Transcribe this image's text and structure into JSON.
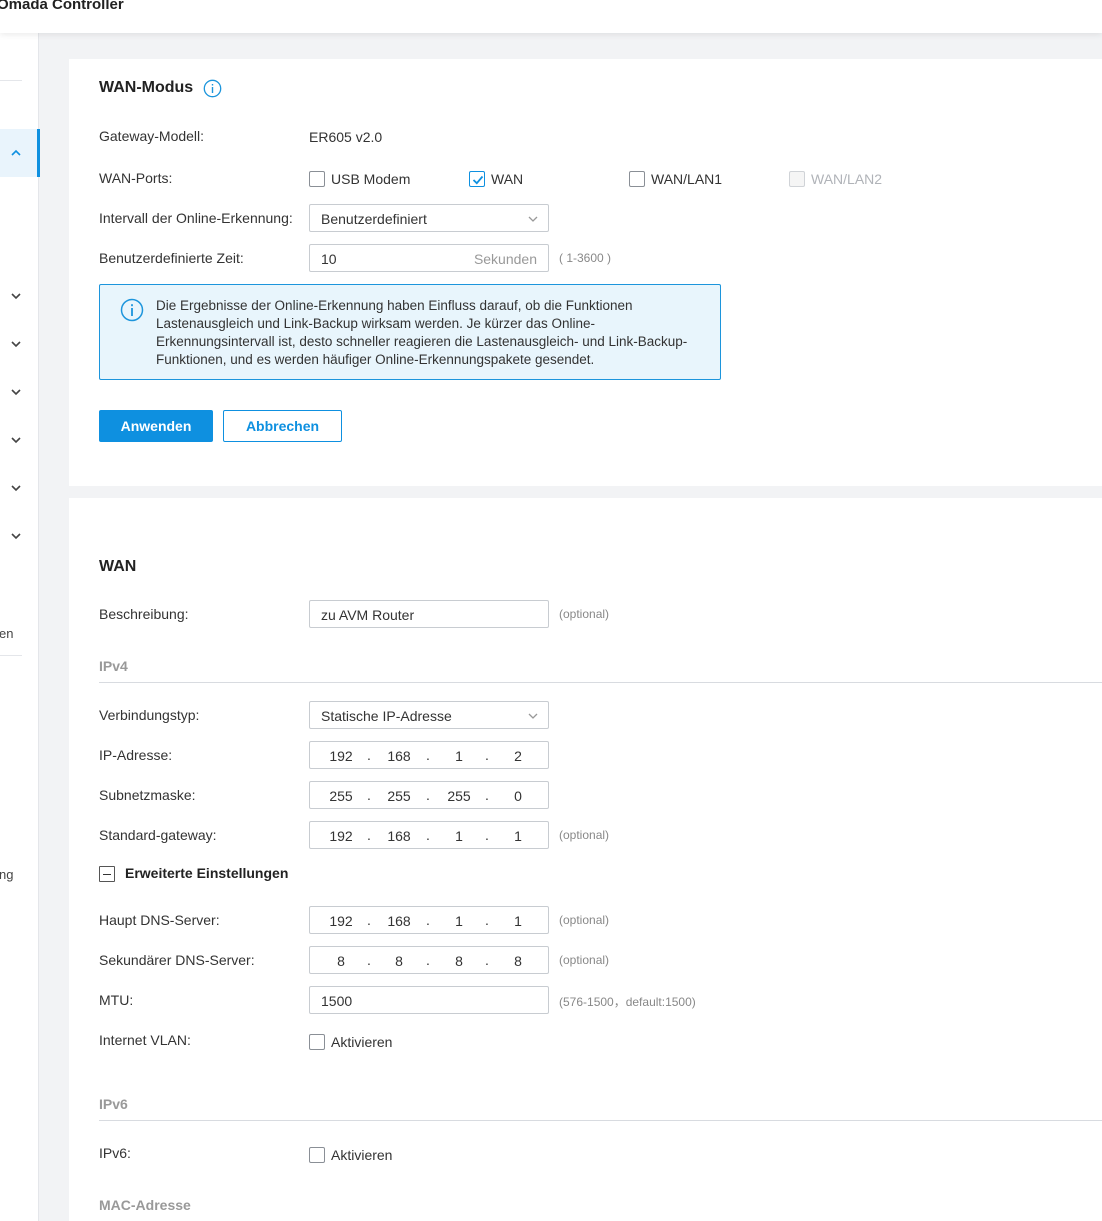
{
  "app": {
    "title": "Omada Controller"
  },
  "sidebar": {
    "fragments": [
      "en",
      "ng"
    ]
  },
  "wan_mode": {
    "title": "WAN-Modus",
    "gateway_model_label": "Gateway-Modell:",
    "gateway_model_value": "ER605 v2.0",
    "wan_ports_label": "WAN-Ports:",
    "ports": [
      {
        "label": "USB Modem",
        "checked": false,
        "disabled": false
      },
      {
        "label": "WAN",
        "checked": true,
        "disabled": false
      },
      {
        "label": "WAN/LAN1",
        "checked": false,
        "disabled": false
      },
      {
        "label": "WAN/LAN2",
        "checked": false,
        "disabled": true
      }
    ],
    "interval_label": "Intervall der Online-Erkennung:",
    "interval_value": "Benutzerdefiniert",
    "custom_time_label": "Benutzerdefinierte Zeit:",
    "custom_time_value": "10",
    "custom_time_unit": "Sekunden",
    "custom_time_range": "( 1-3600 )",
    "info_text": "Die Ergebnisse der Online-Erkennung haben Einfluss darauf, ob die Funktionen Lastenausgleich und Link-Backup wirksam werden. Je kürzer das Online-Erkennungsintervall ist, desto schneller reagieren die Lastenausgleich- und Link-Backup-Funktionen, und es werden häufiger Online-Erkennungspakete gesendet.",
    "apply_label": "Anwenden",
    "cancel_label": "Abbrechen"
  },
  "wan": {
    "title": "WAN",
    "description_label": "Beschreibung:",
    "description_value": "zu AVM Router",
    "optional": "(optional)",
    "ipv4_section": "IPv4",
    "connection_type_label": "Verbindungstyp:",
    "connection_type_value": "Statische IP-Adresse",
    "ip_label": "IP-Adresse:",
    "ip": [
      "192",
      "168",
      "1",
      "2"
    ],
    "subnet_label": "Subnetzmaske:",
    "subnet": [
      "255",
      "255",
      "255",
      "0"
    ],
    "gateway_label": "Standard-gateway:",
    "gateway": [
      "192",
      "168",
      "1",
      "1"
    ],
    "advanced_label": "Erweiterte Einstellungen",
    "dns1_label": "Haupt DNS-Server:",
    "dns1": [
      "192",
      "168",
      "1",
      "1"
    ],
    "dns2_label": "Sekundärer DNS-Server:",
    "dns2": [
      "8",
      "8",
      "8",
      "8"
    ],
    "mtu_label": "MTU:",
    "mtu_value": "1500",
    "mtu_hint": "(576-1500，default:1500)",
    "vlan_label": "Internet VLAN:",
    "vlan_checkbox": "Aktivieren",
    "ipv6_section": "IPv6",
    "ipv6_label": "IPv6:",
    "ipv6_checkbox": "Aktivieren",
    "mac_section": "MAC-Adresse"
  },
  "colors": {
    "accent": "#0e90e0",
    "info_bg": "#e8f5fc",
    "background": "#f2f3f5"
  }
}
